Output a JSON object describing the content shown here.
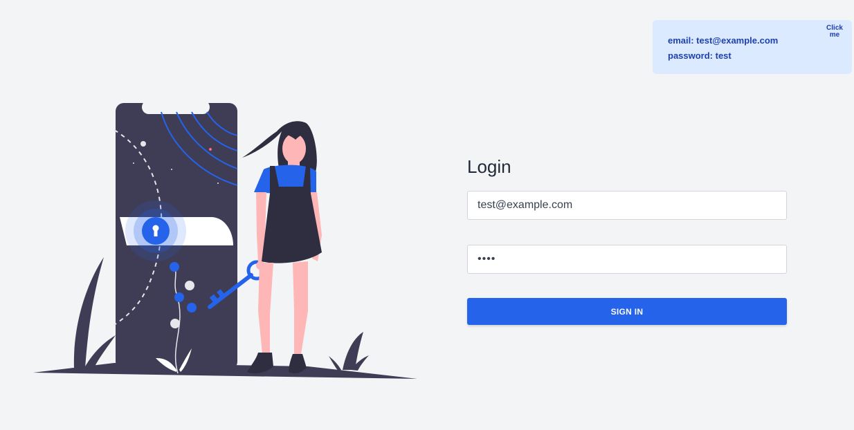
{
  "hint": {
    "email_line": "email: test@example.com",
    "password_line": "password: test",
    "click_label": "Click me"
  },
  "login": {
    "title": "Login",
    "email_value": "test@example.com",
    "password_value": "test",
    "submit_label": "SIGN IN"
  },
  "colors": {
    "background": "#f3f4f6",
    "accent": "#2563eb",
    "hint_background": "#dbeafe",
    "hint_text": "#1e40af",
    "phone_body": "#3f3d56",
    "skin": "#ffb6b6"
  },
  "illustration": {
    "icons": [
      "phone-icon",
      "keyhole-icon",
      "key-icon",
      "woman-figure",
      "plant-icon"
    ]
  }
}
